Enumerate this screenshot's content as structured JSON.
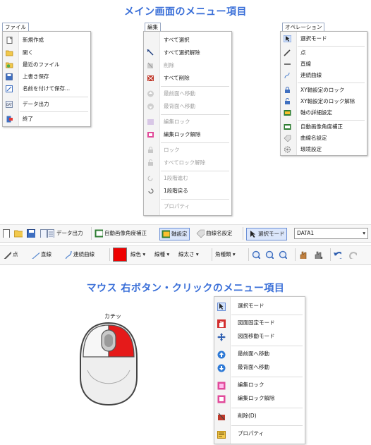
{
  "title_main": "メイン画面のメニュー項目",
  "title_mouse": "マウス 右ボタン・クリックのメニュー項目",
  "file_menu": {
    "header": "ファイル",
    "items": [
      {
        "label": "新規作成",
        "icon": "new-doc-icon"
      },
      {
        "label": "開く",
        "icon": "open-folder-icon"
      },
      {
        "label": "最近のファイル",
        "icon": "recent-files-icon"
      },
      {
        "label": "上書き保存",
        "icon": "save-icon"
      },
      {
        "label": "名前を付けて保存...",
        "icon": "save-as-icon"
      },
      {
        "label": "データ出力",
        "icon": "data-export-icon"
      },
      {
        "label": "終了",
        "icon": "exit-icon"
      }
    ]
  },
  "edit_menu": {
    "header": "編集",
    "items": [
      {
        "label": "すべて選択",
        "disabled": false
      },
      {
        "label": "すべて選択解除",
        "disabled": false
      },
      {
        "label": "削除",
        "disabled": true
      },
      {
        "label": "すべて削除",
        "disabled": false
      },
      {
        "label": "最前面へ移動",
        "disabled": true
      },
      {
        "label": "最背面へ移動",
        "disabled": true
      },
      {
        "label": "編集ロック",
        "disabled": false
      },
      {
        "label": "編集ロック解除",
        "disabled": false
      },
      {
        "label": "ロック",
        "disabled": true
      },
      {
        "label": "すべてロック解除",
        "disabled": true
      },
      {
        "label": "1段階進む",
        "disabled": true
      },
      {
        "label": "1段階戻る",
        "disabled": false
      },
      {
        "label": "プロパティ",
        "disabled": true
      }
    ]
  },
  "operation_menu": {
    "header": "オペレーション",
    "items": [
      {
        "label": "選択モード"
      },
      {
        "label": "点"
      },
      {
        "label": "直線"
      },
      {
        "label": "連続曲線"
      },
      {
        "label": "XY軸設定のロック"
      },
      {
        "label": "XY軸設定のロック解除"
      },
      {
        "label": "軸の詳細設定"
      },
      {
        "label": "自動画像角度補正"
      },
      {
        "label": "曲線名設定"
      },
      {
        "label": "環境設定"
      }
    ]
  },
  "toolbar1": {
    "data_export": "データ出力",
    "auto_angle": "自動画像角度補正",
    "axis_setting": "軸設定",
    "curve_name": "曲線名設定",
    "select_mode": "選択モード",
    "data_select": "DATA1"
  },
  "toolbar2": {
    "point": "点",
    "line": "直線",
    "curve": "連続曲線",
    "line_color": "線色",
    "line_type": "線種",
    "line_width": "線太さ",
    "corner_mark": "角種類",
    "color_swatch": "#ee0000"
  },
  "mouse": {
    "click_label": "カチッ",
    "button_color": "#e51a1a"
  },
  "context_menu": {
    "items": [
      {
        "label": "選択モード"
      },
      {
        "label": "図面固定モード"
      },
      {
        "label": "図面移動モード"
      },
      {
        "label": "最前面へ移動"
      },
      {
        "label": "最背面へ移動"
      },
      {
        "label": "編集ロック"
      },
      {
        "label": "編集ロック解除"
      },
      {
        "label": "削除(D)"
      },
      {
        "label": "プロパティ"
      }
    ]
  }
}
